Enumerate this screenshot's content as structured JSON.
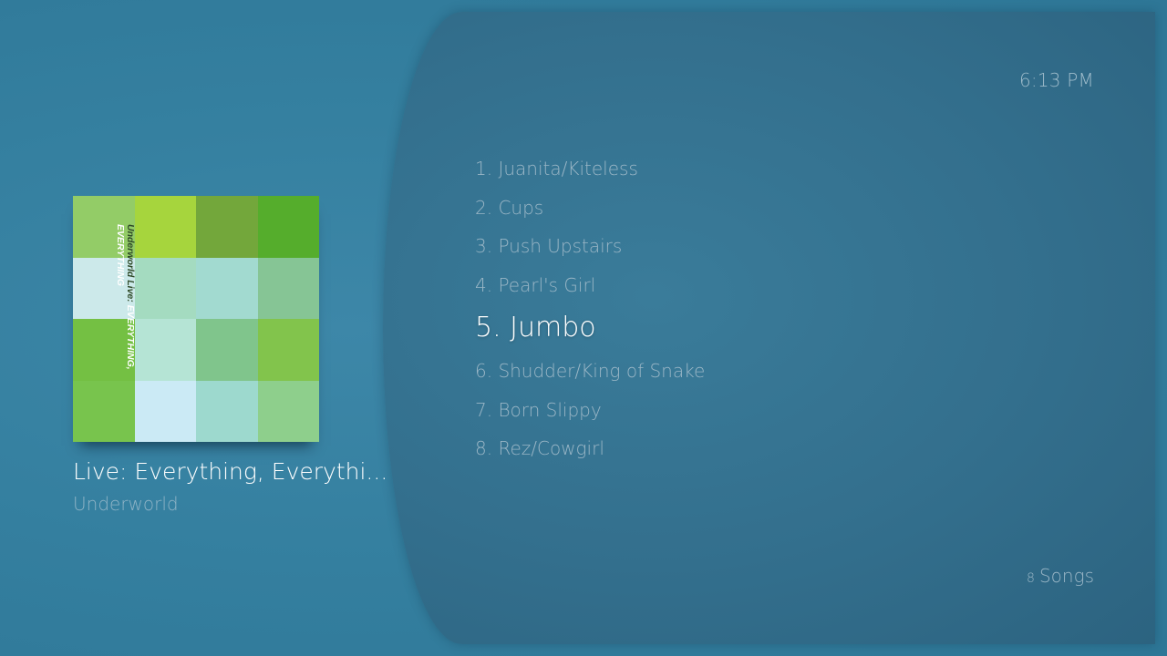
{
  "clock": "6:13 PM",
  "tracks": [
    {
      "label": "1. Juanita/Kiteless",
      "selected": false
    },
    {
      "label": "2. Cups",
      "selected": false
    },
    {
      "label": "3. Push Upstairs",
      "selected": false
    },
    {
      "label": "4. Pearl's Girl",
      "selected": false
    },
    {
      "label": "5. Jumbo",
      "selected": true
    },
    {
      "label": "6. Shudder/King of Snake",
      "selected": false
    },
    {
      "label": "7. Born Slippy",
      "selected": false
    },
    {
      "label": "8. Rez/Cowgirl",
      "selected": false
    }
  ],
  "album": {
    "title": "Live: Everything, Everythi...",
    "artist": "Underworld",
    "cover_text_line1_dark": "Underworld Live: ",
    "cover_text_line1_light": "EVERYTHING,",
    "cover_text_line2": "EVERYTHING",
    "cover_colors": [
      "#93cc67",
      "#a6d53d",
      "#73a73b",
      "#55ad2c",
      "#cce9ea",
      "#a4dbc0",
      "#a2dad0",
      "#86c595",
      "#74c043",
      "#b5e4d5",
      "#80c58c",
      "#82c44c",
      "#78c44d",
      "#cbeaf5",
      "#9dd9ce",
      "#8ecf8c"
    ]
  },
  "footer": {
    "count": "8",
    "count_label": "Songs"
  }
}
